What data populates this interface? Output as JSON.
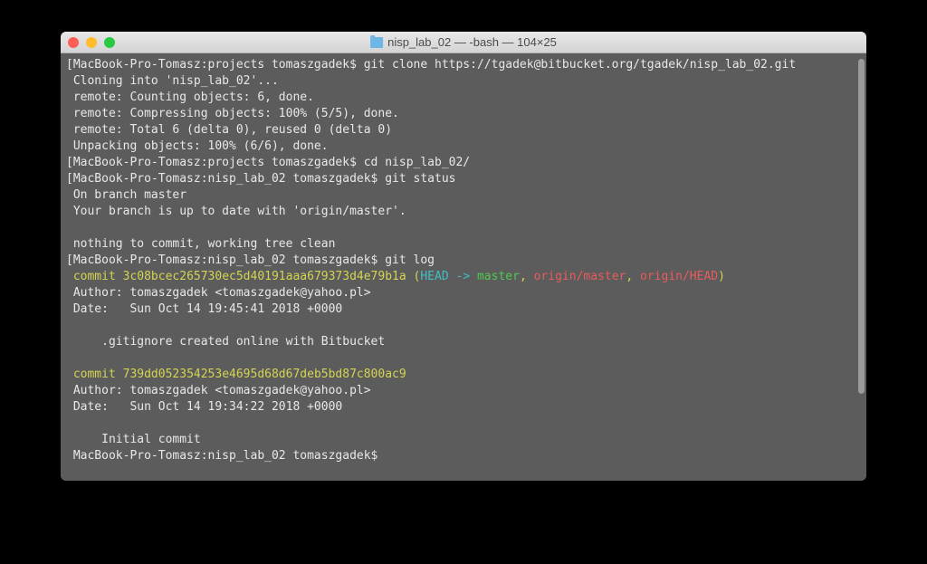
{
  "window": {
    "title": "nisp_lab_02 — -bash — 104×25"
  },
  "terminal": {
    "line1_prompt": "[MacBook-Pro-Tomasz:projects tomaszgadek$ ",
    "line1_cmd": "git clone https://tgadek@bitbucket.org/tgadek/nisp_lab_02.git",
    "line2": " Cloning into 'nisp_lab_02'...",
    "line3": " remote: Counting objects: 6, done.",
    "line4": " remote: Compressing objects: 100% (5/5), done.",
    "line5": " remote: Total 6 (delta 0), reused 0 (delta 0)",
    "line6": " Unpacking objects: 100% (6/6), done.",
    "line7_prompt": "[MacBook-Pro-Tomasz:projects tomaszgadek$ ",
    "line7_cmd": "cd nisp_lab_02/",
    "line8_prompt": "[MacBook-Pro-Tomasz:nisp_lab_02 tomaszgadek$ ",
    "line8_cmd": "git status",
    "line9": " On branch master",
    "line10": " Your branch is up to date with 'origin/master'.",
    "line11": " ",
    "line12": " nothing to commit, working tree clean",
    "line13_prompt": "[MacBook-Pro-Tomasz:nisp_lab_02 tomaszgadek$ ",
    "line13_cmd": "git log",
    "commit1_label": " commit ",
    "commit1_hash": "3c08bcec265730ec5d40191aaa679373d4e79b1a",
    "commit1_open": " (",
    "commit1_head": "HEAD -> ",
    "commit1_master": "master",
    "commit1_sep1": ", ",
    "commit1_origin_master": "origin/master",
    "commit1_sep2": ", ",
    "commit1_origin_head": "origin/HEAD",
    "commit1_close": ")",
    "commit1_author": " Author: tomaszgadek <tomaszgadek@yahoo.pl>",
    "commit1_date": " Date:   Sun Oct 14 19:45:41 2018 +0000",
    "commit1_blank": " ",
    "commit1_msg": "     .gitignore created online with Bitbucket",
    "commit1_blank2": " ",
    "commit2_label": " commit ",
    "commit2_hash": "739dd052354253e4695d68d67deb5bd87c800ac9",
    "commit2_author": " Author: tomaszgadek <tomaszgadek@yahoo.pl>",
    "commit2_date": " Date:   Sun Oct 14 19:34:22 2018 +0000",
    "commit2_blank": " ",
    "commit2_msg": "     Initial commit",
    "final_prompt": " MacBook-Pro-Tomasz:nisp_lab_02 tomaszgadek$ "
  }
}
